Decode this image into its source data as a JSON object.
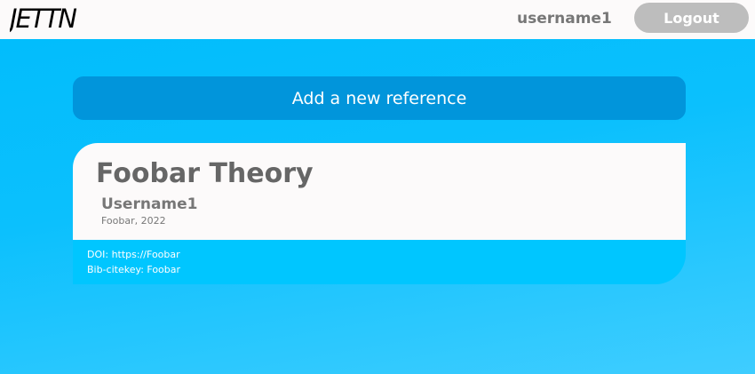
{
  "navbar": {
    "logo_text": "JETTN",
    "username": "username1",
    "logout_label": "Logout"
  },
  "main": {
    "add_reference_label": "Add a new reference",
    "reference_card": {
      "title": "Foobar Theory",
      "author": "Username1",
      "publisher_year": "Foobar, 2022",
      "doi": "DOI: https://Foobar",
      "bib_citekey": "Bib-citekey: Foobar"
    }
  },
  "colors": {
    "background": "#00bcfc",
    "navbar_bg": "#fcfafa",
    "add_button_bg": "#0195db",
    "logout_bg": "#bdbdbd",
    "card_top_bg": "#fcfafa",
    "card_bottom_bg": "#00c6ff",
    "muted_text": "#777777"
  }
}
